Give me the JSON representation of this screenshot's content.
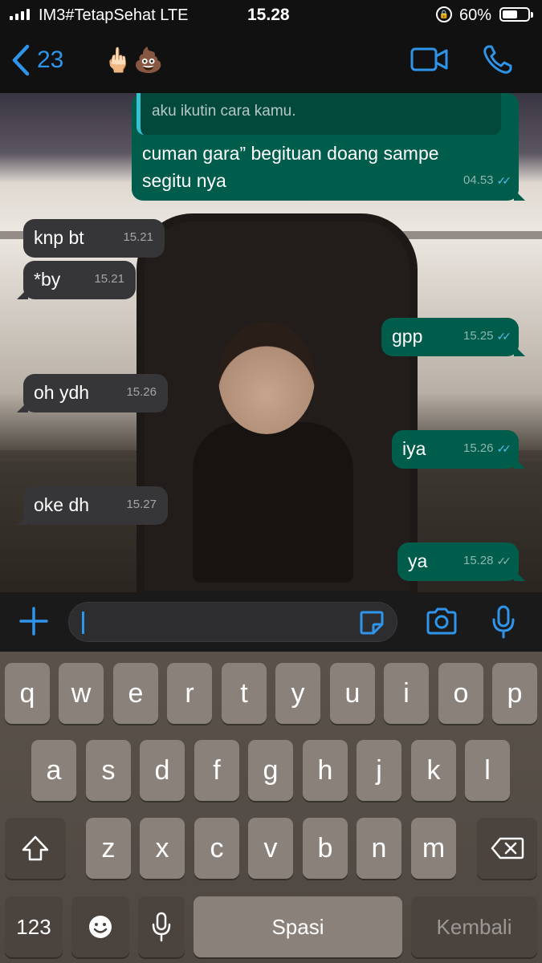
{
  "status_bar": {
    "carrier": "IM3#TetapSehat  LTE",
    "time": "15.28",
    "battery_percent": "60%",
    "battery_level": 0.6
  },
  "header": {
    "back_count": "23",
    "emoji_1": "🖕🏻",
    "emoji_2": "💩",
    "accent_color": "#2f95ea"
  },
  "messages": {
    "quoted_text": "aku ikutin cara kamu.",
    "m0_text_line1": "cuman gara” begituan doang sampe",
    "m0_text_line2": "segitu nya",
    "m0_time": "04.53",
    "m1_text": "knp bt",
    "m1_time": "15.21",
    "m2_text": "*by",
    "m2_time": "15.21",
    "m3_text": "gpp",
    "m3_time": "15.25",
    "m4_text": "oh ydh",
    "m4_time": "15.26",
    "m5_text": "iya",
    "m5_time": "15.26",
    "m6_text": "oke dh",
    "m6_time": "15.27",
    "m7_text": "ya",
    "m7_time": "15.28"
  },
  "input": {
    "value": ""
  },
  "keyboard": {
    "row1": [
      "q",
      "w",
      "e",
      "r",
      "t",
      "y",
      "u",
      "i",
      "o",
      "p"
    ],
    "row2": [
      "a",
      "s",
      "d",
      "f",
      "g",
      "h",
      "j",
      "k",
      "l"
    ],
    "row3": [
      "z",
      "x",
      "c",
      "v",
      "b",
      "n",
      "m"
    ],
    "numbers_label": "123",
    "space_label": "Spasi",
    "return_label": "Kembali"
  },
  "icons": {
    "back": "chevron-left-icon",
    "video": "video-call-icon",
    "phone": "phone-icon",
    "plus": "plus-icon",
    "sticker": "sticker-icon",
    "camera": "camera-icon",
    "mic": "microphone-icon",
    "shift": "shift-icon",
    "delete": "backspace-icon",
    "emoji": "emoji-icon",
    "dictation": "dictation-icon"
  }
}
